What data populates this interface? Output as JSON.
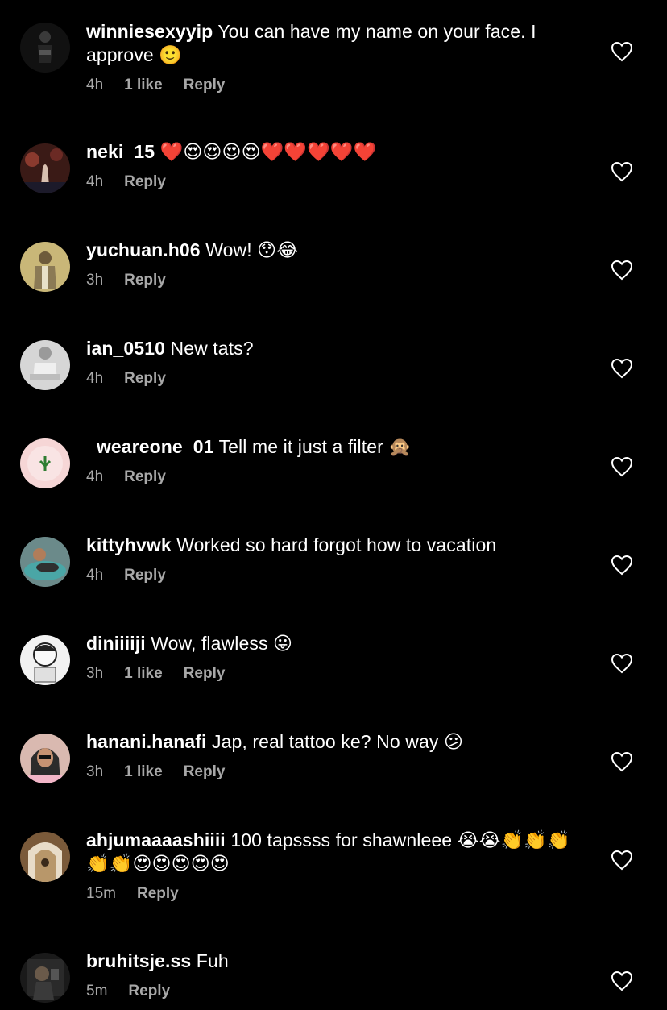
{
  "comments": [
    {
      "user": "winniesexyyip",
      "text": "You can have my name on your face. I approve 🙂",
      "time": "4h",
      "likes": "1 like",
      "reply": "Reply",
      "avatar": "a-dark-figure"
    },
    {
      "user": "neki_15",
      "text": "❤️😍😍😍😍❤️❤️❤️❤️❤️",
      "time": "4h",
      "likes": "",
      "reply": "Reply",
      "avatar": "a-stage"
    },
    {
      "user": "yuchuan.h06",
      "text": "Wow! 😯😂",
      "time": "3h",
      "likes": "",
      "reply": "Reply",
      "avatar": "a-soldier"
    },
    {
      "user": "ian_0510",
      "text": "New tats?",
      "time": "4h",
      "likes": "",
      "reply": "Reply",
      "avatar": "a-seated"
    },
    {
      "user": "_weareone_01",
      "text": "Tell me it just a filter 🙊",
      "time": "4h",
      "likes": "",
      "reply": "Reply",
      "avatar": "a-pink"
    },
    {
      "user": "kittyhvwk",
      "text": "Worked so hard forgot how to vacation",
      "time": "4h",
      "likes": "",
      "reply": "Reply",
      "avatar": "a-pool"
    },
    {
      "user": "diniiiiji",
      "text": "Wow, flawless 😛",
      "time": "3h",
      "likes": "1 like",
      "reply": "Reply",
      "avatar": "a-cartoon"
    },
    {
      "user": "hanani.hanafi",
      "text": "Jap, real tattoo ke? No way 😕",
      "time": "3h",
      "likes": "1 like",
      "reply": "Reply",
      "avatar": "a-hijab"
    },
    {
      "user": "ahjumaaaashiiii",
      "text": "100 tapssss for shawnleee 😭😭👏👏👏👏👏😍😍😍😍😍",
      "time": "15m",
      "likes": "",
      "reply": "Reply",
      "avatar": "a-arch"
    },
    {
      "user": "bruhitsje.ss",
      "text": "Fuh",
      "time": "5m",
      "likes": "",
      "reply": "Reply",
      "avatar": "a-mirror"
    }
  ]
}
